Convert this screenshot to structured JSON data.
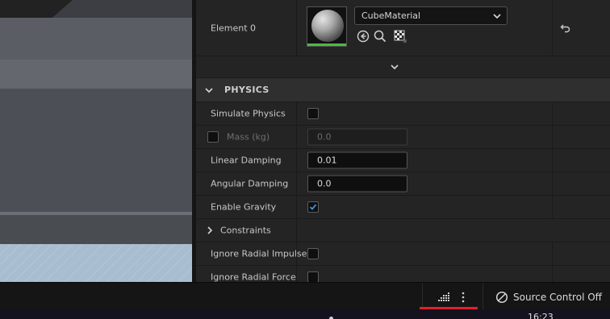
{
  "material_row": {
    "label": "Element 0",
    "material_name": "CubeMaterial",
    "icons": [
      "browse-back-icon",
      "search-icon",
      "checker-material-icon"
    ]
  },
  "physics": {
    "category_title": "PHYSICS",
    "simulate_physics": {
      "label": "Simulate Physics",
      "checked": false
    },
    "mass": {
      "label": "Mass (kg)",
      "value": "0.0",
      "enabled": false
    },
    "linear_damping": {
      "label": "Linear Damping",
      "value": "0.01"
    },
    "angular_damping": {
      "label": "Angular Damping",
      "value": "0.0"
    },
    "enable_gravity": {
      "label": "Enable Gravity",
      "checked": true
    },
    "constraints": {
      "label": "Constraints",
      "expanded": false
    },
    "ignore_radial_impulse": {
      "label": "Ignore Radial Impulse",
      "checked": false
    },
    "ignore_radial_force": {
      "label": "Ignore Radial Force",
      "checked": false
    }
  },
  "status_bar": {
    "source_control_label": "Source Control Off",
    "icons": [
      "derived-data-icon",
      "more-options-icon",
      "source-control-off-icon"
    ]
  },
  "taskbar": {
    "time": "16:23"
  },
  "colors": {
    "accent_check": "#3b8fe0",
    "thumbnail_bar": "#4fb844",
    "highlight_underline": "#e0212a"
  }
}
